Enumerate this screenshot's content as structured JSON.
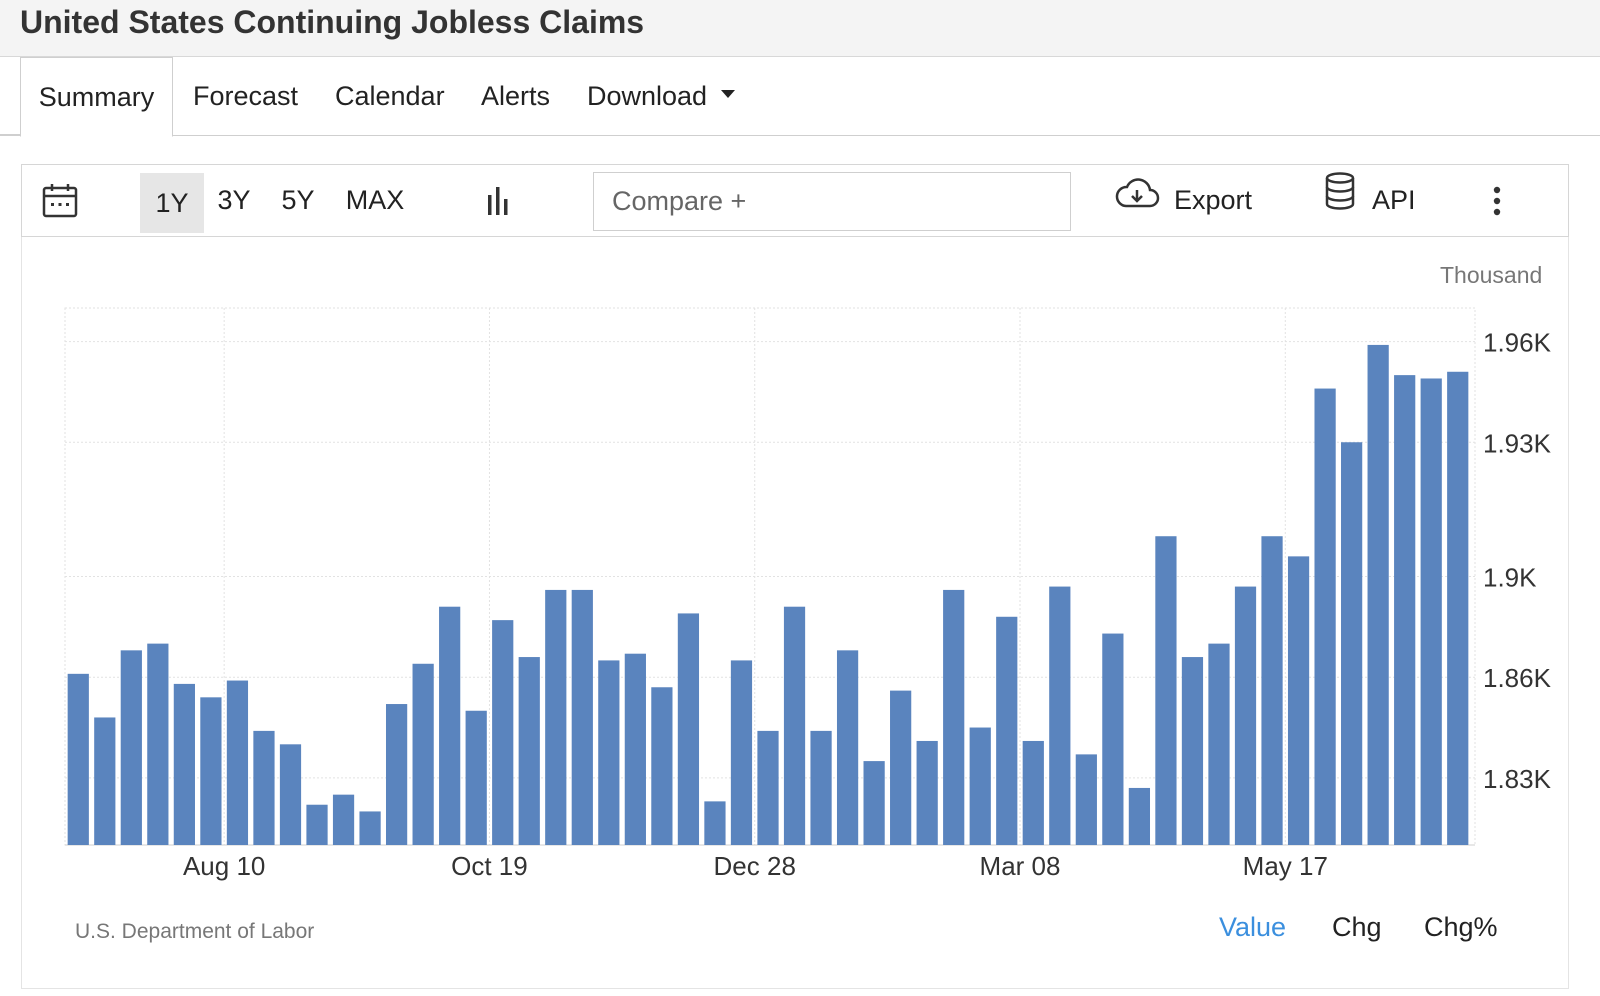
{
  "page": {
    "title": "United States Continuing Jobless Claims"
  },
  "tabs": [
    {
      "label": "Summary",
      "active": true
    },
    {
      "label": "Forecast"
    },
    {
      "label": "Calendar"
    },
    {
      "label": "Alerts"
    },
    {
      "label": "Download",
      "has_dropdown": true
    }
  ],
  "toolbar": {
    "calendar_icon": "calendar-icon",
    "ranges": [
      {
        "label": "1Y",
        "active": true
      },
      {
        "label": "3Y"
      },
      {
        "label": "5Y"
      },
      {
        "label": "MAX"
      }
    ],
    "chart_type_icon": "bar-chart-icon",
    "compare_placeholder": "Compare +",
    "export_label": "Export",
    "export_icon": "cloud-download-icon",
    "api_label": "API",
    "api_icon": "database-icon",
    "more_icon": "vertical-ellipsis-icon"
  },
  "footer": {
    "source": "U.S. Department of Labor",
    "modes": [
      {
        "label": "Value",
        "active": true
      },
      {
        "label": "Chg"
      },
      {
        "label": "Chg%"
      }
    ]
  },
  "colors": {
    "bar": "#5a84be",
    "active_mode": "#3b8fde",
    "grid": "#e2e2e2"
  },
  "chart_data": {
    "type": "bar",
    "unit_label": "Thousand",
    "y_ticks": [
      1830,
      1860,
      1890,
      1930,
      1960
    ],
    "y_tick_labels": [
      "1.83K",
      "1.86K",
      "1.9K",
      "1.93K",
      "1.96K"
    ],
    "ylim": [
      1810,
      1970
    ],
    "grid": true,
    "x_tick_labels": [
      {
        "label": "Aug 10",
        "index": 5.5
      },
      {
        "label": "Oct 19",
        "index": 15.5
      },
      {
        "label": "Dec 28",
        "index": 25.5
      },
      {
        "label": "Mar 08",
        "index": 35.5
      },
      {
        "label": "May 17",
        "index": 45.5
      }
    ],
    "series": [
      {
        "values": [
          1861,
          1848,
          1868,
          1870,
          1858,
          1854,
          1859,
          1844,
          1840,
          1822,
          1825,
          1820,
          1852,
          1864,
          1881,
          1850,
          1877,
          1866,
          1886,
          1886,
          1865,
          1867,
          1857,
          1879,
          1823,
          1865,
          1844,
          1881,
          1844,
          1868,
          1835,
          1856,
          1841,
          1886,
          1845,
          1878,
          1841,
          1887,
          1837,
          1873,
          1827,
          1902,
          1866,
          1870,
          1887,
          1902,
          1896,
          1946,
          1930,
          1959,
          1950,
          1949,
          1951
        ]
      }
    ]
  }
}
